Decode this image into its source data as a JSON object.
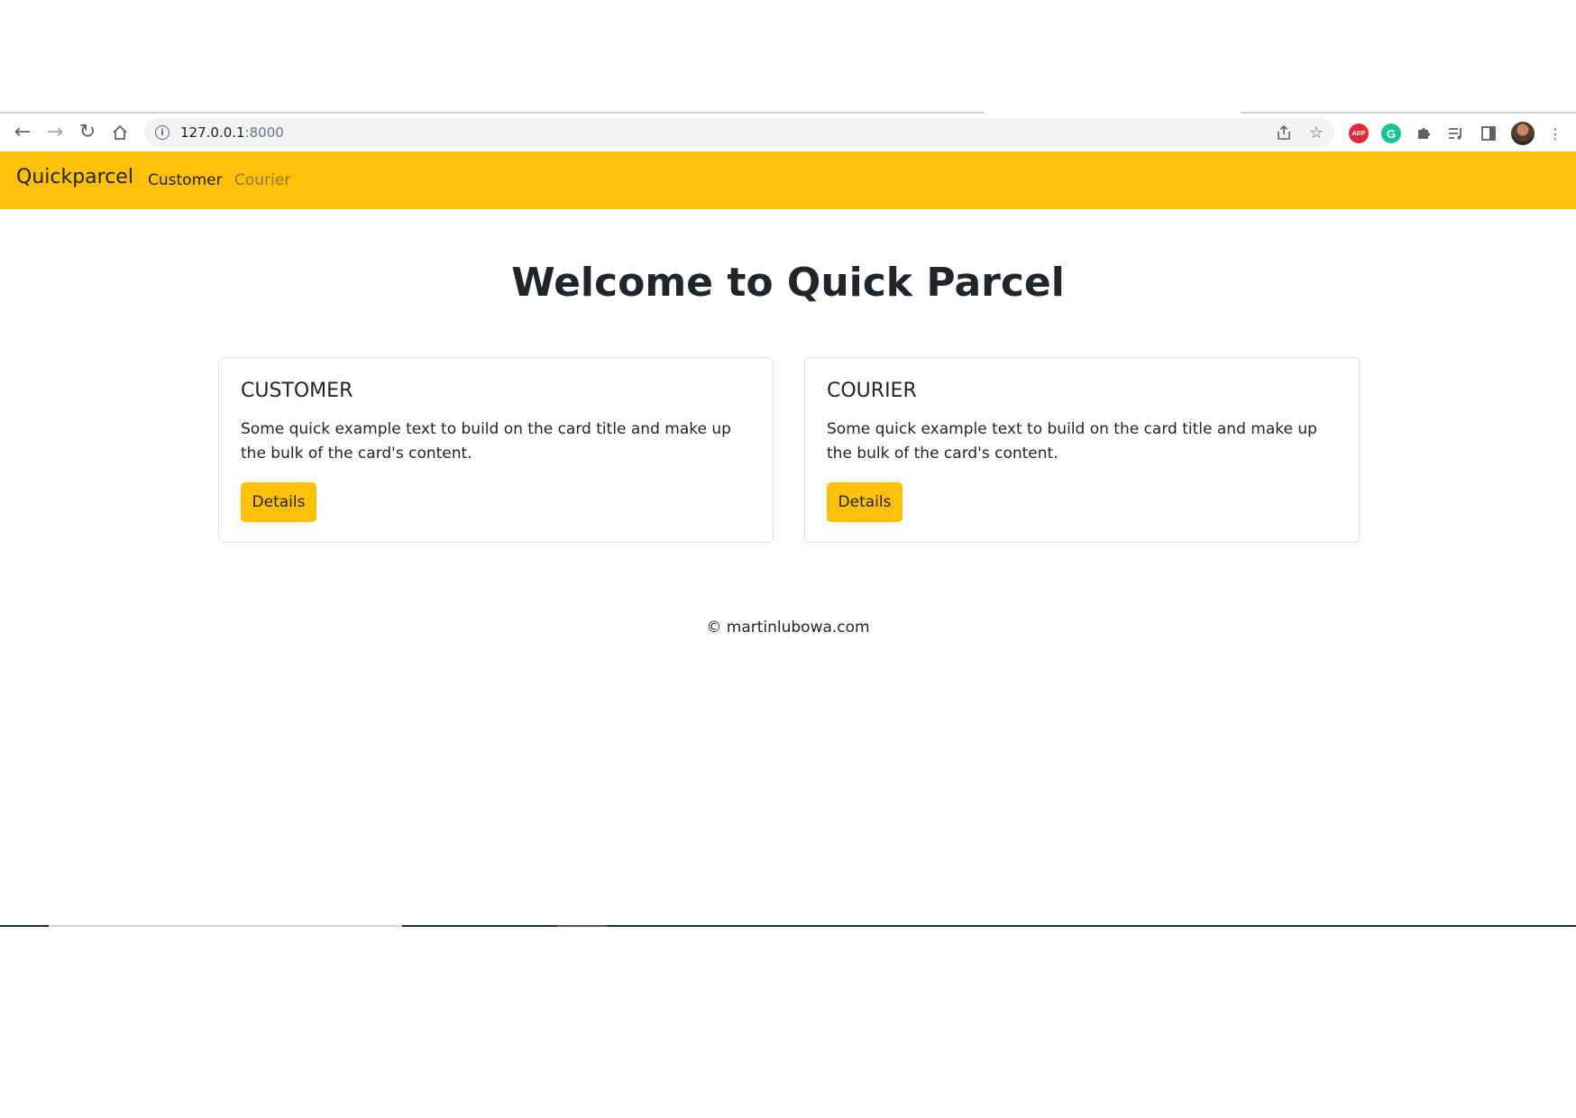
{
  "browser": {
    "url_host": "127.0.0.1",
    "url_port": ":8000",
    "extensions": {
      "abp_label": "ABP",
      "grammarly_label": "G"
    }
  },
  "navbar": {
    "brand": "Quickparcel",
    "links": [
      {
        "label": "Customer",
        "active": true
      },
      {
        "label": "Courier",
        "active": false
      }
    ],
    "background": "#ffc107"
  },
  "main": {
    "heading": "Welcome to Quick Parcel",
    "cards": [
      {
        "title": "CUSTOMER",
        "text": "Some quick example text to build on the card title and make up the bulk of the card's content.",
        "button": "Details"
      },
      {
        "title": "COURIER",
        "text": "Some quick example text to build on the card title and make up the bulk of the card's content.",
        "button": "Details"
      }
    ]
  },
  "footer": {
    "text": "© martinlubowa.com"
  },
  "icons": [
    "back-arrow-icon",
    "forward-arrow-icon",
    "reload-icon",
    "home-icon",
    "info-icon",
    "share-icon",
    "star-icon",
    "extensions-puzzle-icon",
    "reading-list-icon",
    "side-panel-icon",
    "menu-dots-icon"
  ]
}
